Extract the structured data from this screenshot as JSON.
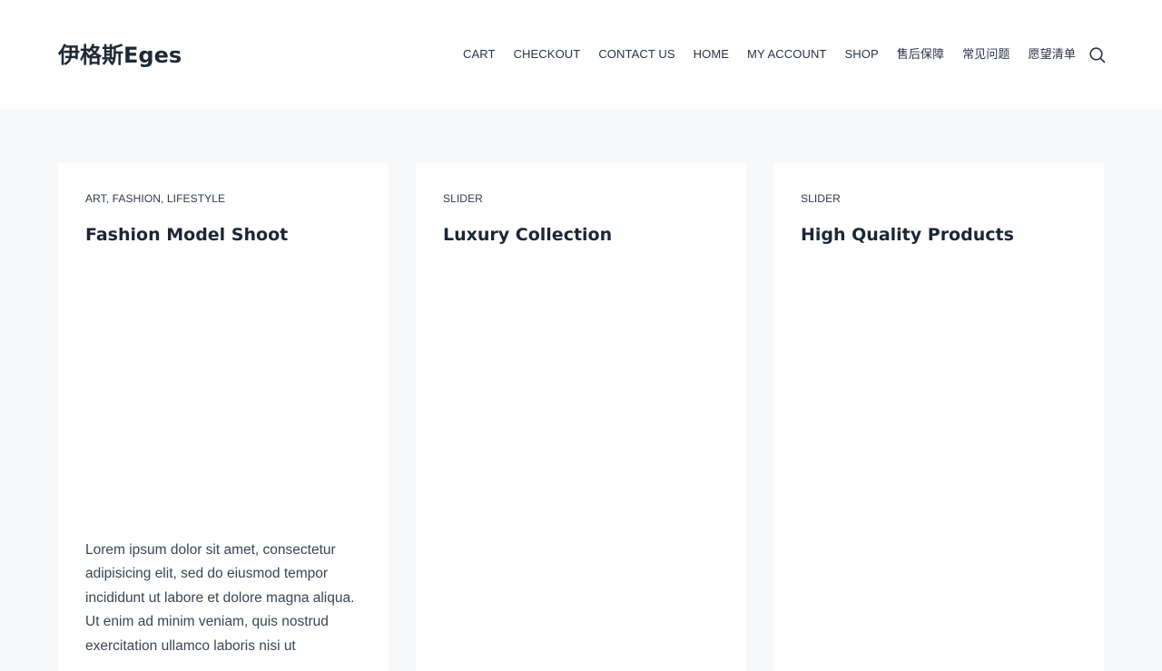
{
  "site": {
    "logo": "伊格斯Eges"
  },
  "nav": {
    "items": [
      "CART",
      "CHECKOUT",
      "CONTACT US",
      "HOME",
      "MY ACCOUNT",
      "SHOP",
      "售后保障",
      "常见问题",
      "愿望清单"
    ],
    "search_icon": "search-icon"
  },
  "posts": [
    {
      "categories": [
        "ART",
        "FASHION",
        "LIFESTYLE"
      ],
      "title": "Fashion Model Shoot",
      "excerpt": "Lorem ipsum dolor sit amet, consectetur adipisicing elit, sed do eiusmod tempor incididunt ut labore et dolore magna aliqua. Ut enim ad minim veniam, quis nostrud exercitation ullamco laboris nisi ut"
    },
    {
      "categories": [
        "SLIDER"
      ],
      "title": "Luxury Collection",
      "excerpt": ""
    },
    {
      "categories": [
        "SLIDER"
      ],
      "title": "High Quality Products",
      "excerpt": ""
    }
  ],
  "colors": {
    "page_background": "#f7f8fa",
    "card_background": "#ffffff",
    "heading": "#1b2736",
    "text": "#3a4554"
  }
}
